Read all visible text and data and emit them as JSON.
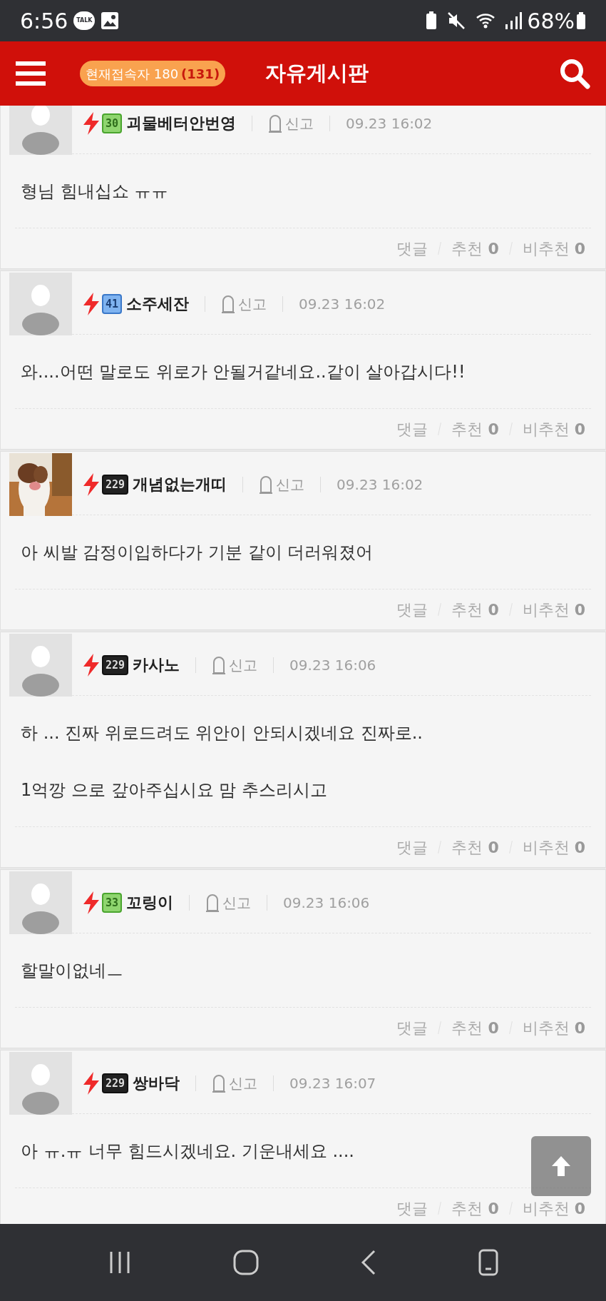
{
  "status_bar": {
    "time": "6:56",
    "talk_label": "TALK",
    "battery": "68%"
  },
  "header": {
    "online_label": "현재접속자 180",
    "online_count": "(131)",
    "title": "자유게시판"
  },
  "comments": [
    {
      "author": "괴물베터안번영",
      "badge": {
        "kind": "green",
        "rank": "30"
      },
      "avatar": {
        "kind": "default"
      },
      "report": "신고",
      "time": "09.23 16:02",
      "paragraphs": [
        "형님 힘내십쇼 ㅠㅠ"
      ],
      "reply": "댓글",
      "like_label": "추천",
      "likes": "0",
      "dislike_label": "비추천",
      "dislikes": "0"
    },
    {
      "author": "소주세잔",
      "badge": {
        "kind": "blue",
        "rank": "41"
      },
      "avatar": {
        "kind": "default"
      },
      "report": "신고",
      "time": "09.23 16:02",
      "paragraphs": [
        "와....어떤 말로도 위로가 안될거같네요..같이 살아갑시다!!"
      ],
      "reply": "댓글",
      "like_label": "추천",
      "likes": "0",
      "dislike_label": "비추천",
      "dislikes": "0"
    },
    {
      "author": "개념없는개띠",
      "badge": {
        "kind": "dark",
        "rank": "229"
      },
      "avatar": {
        "kind": "picture"
      },
      "report": "신고",
      "time": "09.23 16:02",
      "paragraphs": [
        "아 씨발 감정이입하다가 기분 같이 더러워졌어"
      ],
      "reply": "댓글",
      "like_label": "추천",
      "likes": "0",
      "dislike_label": "비추천",
      "dislikes": "0"
    },
    {
      "author": "카사노",
      "badge": {
        "kind": "dark",
        "rank": "229"
      },
      "avatar": {
        "kind": "default"
      },
      "report": "신고",
      "time": "09.23 16:06",
      "paragraphs": [
        "하 ... 진짜 위로드려도 위안이 안되시겠네요 진짜로..",
        "1억깡 으로 갚아주십시요 맘 추스리시고"
      ],
      "reply": "댓글",
      "like_label": "추천",
      "likes": "0",
      "dislike_label": "비추천",
      "dislikes": "0"
    },
    {
      "author": "꼬링이",
      "badge": {
        "kind": "green",
        "rank": "33"
      },
      "avatar": {
        "kind": "default"
      },
      "report": "신고",
      "time": "09.23 16:06",
      "paragraphs": [
        "할말이없네ㅡ"
      ],
      "reply": "댓글",
      "like_label": "추천",
      "likes": "0",
      "dislike_label": "비추천",
      "dislikes": "0"
    },
    {
      "author": "쌍바닥",
      "badge": {
        "kind": "dark",
        "rank": "229"
      },
      "avatar": {
        "kind": "default"
      },
      "report": "신고",
      "time": "09.23 16:07",
      "paragraphs": [
        "아 ㅠ.ㅠ 너무 힘드시겠네요. 기운내세요 ...."
      ],
      "reply": "댓글",
      "like_label": "추천",
      "likes": "0",
      "dislike_label": "비추천",
      "dislikes": "0"
    }
  ]
}
